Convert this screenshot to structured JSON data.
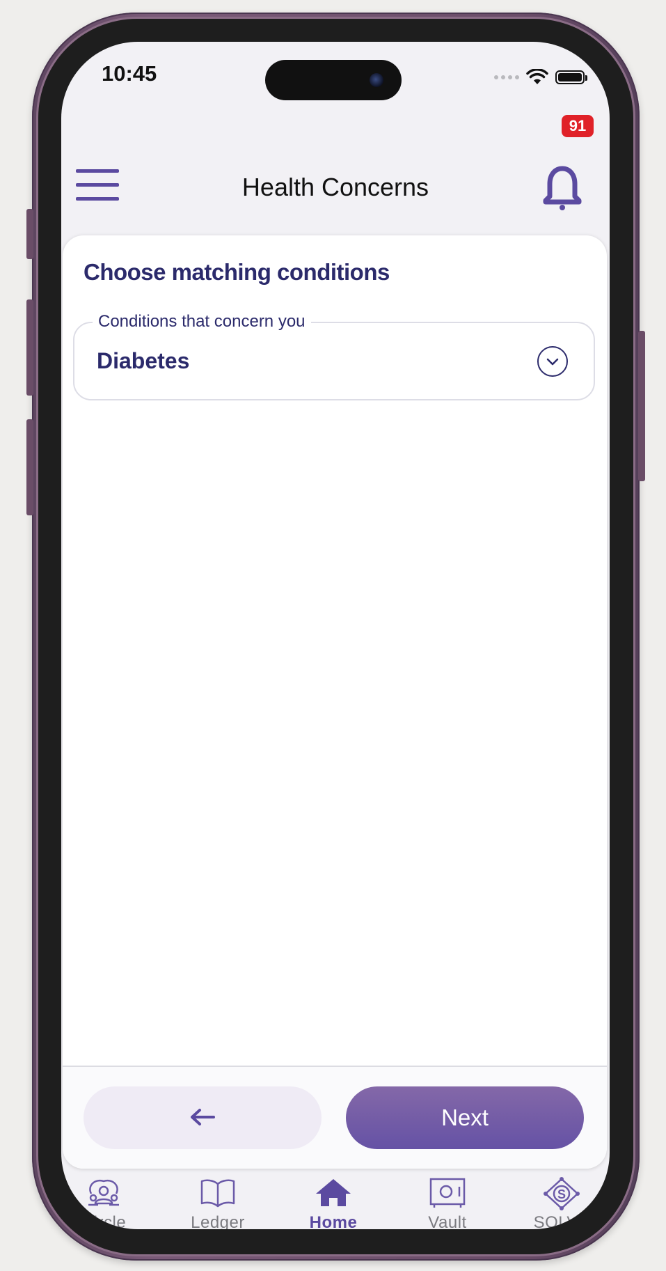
{
  "status_bar": {
    "time": "10:45",
    "notification_count": "91"
  },
  "header": {
    "title": "Health Concerns"
  },
  "card": {
    "heading": "Choose matching conditions",
    "field_label": "Conditions that concern you",
    "field_value": "Diabetes"
  },
  "footer": {
    "back_label": "←",
    "next_label": "Next"
  },
  "tabs": [
    {
      "label": "Circle",
      "icon": "people-circle-icon",
      "active": false
    },
    {
      "label": "Ledger",
      "icon": "open-book-icon",
      "active": false
    },
    {
      "label": "Home",
      "icon": "home-icon",
      "active": true
    },
    {
      "label": "Vault",
      "icon": "safe-icon",
      "active": false
    },
    {
      "label": "SOLVE",
      "icon": "solve-diamond-icon",
      "active": false
    }
  ],
  "colors": {
    "accent": "#5b4aa0",
    "heading_text": "#2b2a6b",
    "badge": "#e02128",
    "back_button_bg": "#efebf5"
  }
}
